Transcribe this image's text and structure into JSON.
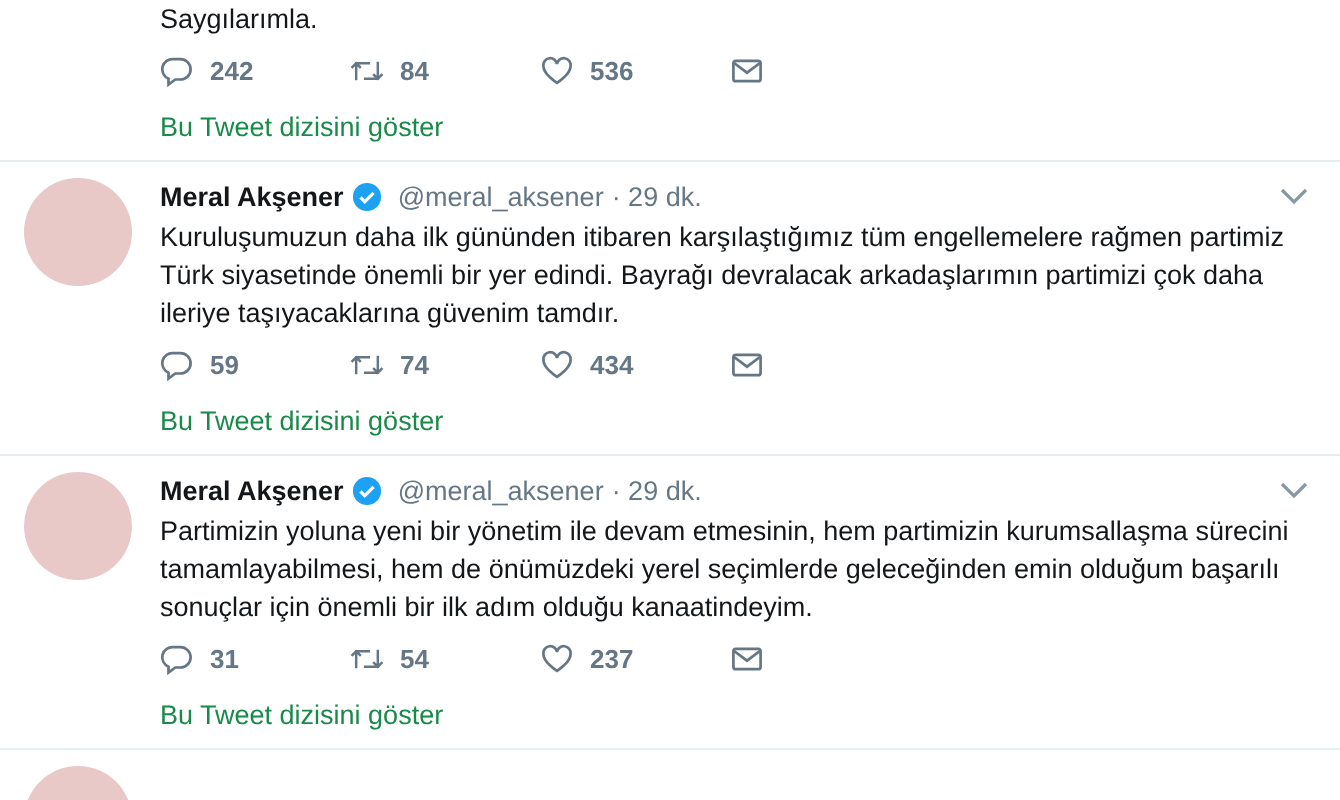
{
  "tweets": [
    {
      "text": "Saygılarımla.",
      "replies": "242",
      "retweets": "84",
      "likes": "536",
      "thread_link": "Bu Tweet dizisini göster"
    },
    {
      "name": "Meral Akşener",
      "verified": true,
      "handle": "@meral_aksener",
      "time": "· 29 dk.",
      "text": "Kuruluşumuzun daha ilk gününden itibaren karşılaştığımız tüm engellemelere rağmen partimiz Türk siyasetinde önemli bir yer edindi. Bayrağı devralacak arkadaşlarımın partimizi çok daha ileriye taşıyacaklarına güvenim tamdır.",
      "replies": "59",
      "retweets": "74",
      "likes": "434",
      "thread_link": "Bu Tweet dizisini göster"
    },
    {
      "name": "Meral Akşener",
      "verified": true,
      "handle": "@meral_aksener",
      "time": "· 29 dk.",
      "text": "Partimizin yoluna yeni bir yönetim ile devam etmesinin, hem partimizin kurumsallaşma sürecini tamamlayabilmesi, hem de önümüzdeki yerel seçimlerde geleceğinden emin olduğum başarılı sonuçlar için önemli bir ilk adım olduğu kanaatindeyim.",
      "replies": "31",
      "retweets": "54",
      "likes": "237",
      "thread_link": "Bu Tweet dizisini göster"
    }
  ]
}
